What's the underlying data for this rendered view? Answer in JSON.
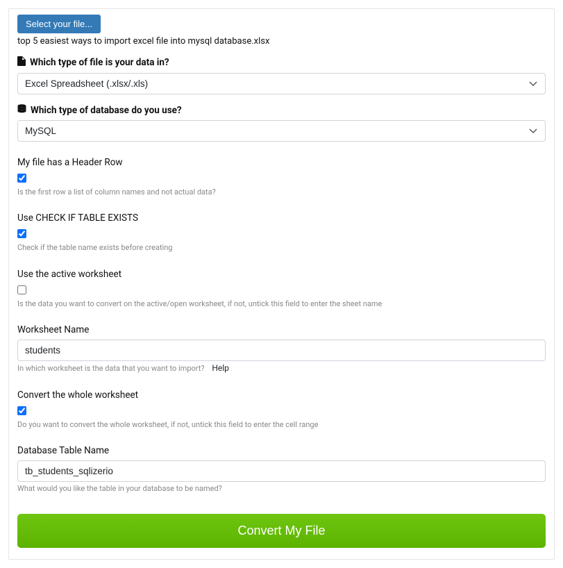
{
  "selectFileButton": "Select your file...",
  "selectedFilename": "top 5 easiest ways to import excel file into mysql database.xlsx",
  "fileType": {
    "label": "Which type of file is your data in?",
    "value": "Excel Spreadsheet (.xlsx/.xls)"
  },
  "dbType": {
    "label": "Which type of database do you use?",
    "value": "MySQL"
  },
  "headerRow": {
    "label": "My file has a Header Row",
    "checked": true,
    "help": "Is the first row a list of column names and not actual data?"
  },
  "checkTable": {
    "label": "Use CHECK IF TABLE EXISTS",
    "checked": true,
    "help": "Check if the table name exists before creating"
  },
  "activeWorksheet": {
    "label": "Use the active worksheet",
    "checked": false,
    "help": "Is the data you want to convert on the active/open worksheet, if not, untick this field to enter the sheet name"
  },
  "worksheetName": {
    "label": "Worksheet Name",
    "value": "students",
    "help": "In which worksheet is the data that you want to import?",
    "helpLink": "Help"
  },
  "convertWhole": {
    "label": "Convert the whole worksheet",
    "checked": true,
    "help": "Do you want to convert the whole worksheet, if not, untick this field to enter the cell range"
  },
  "tableName": {
    "label": "Database Table Name",
    "value": "tb_students_sqlizerio",
    "help": "What would you like the table in your database to be named?"
  },
  "convertButton": "Convert My File"
}
